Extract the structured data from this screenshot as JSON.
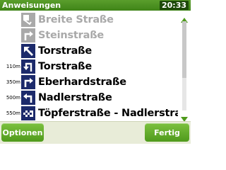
{
  "header": {
    "title": "Anweisungen",
    "clock": "20:33"
  },
  "rows": [
    {
      "distance": "",
      "street": "Breite Straße",
      "state": "past",
      "icon": "roundabout-icon"
    },
    {
      "distance": "",
      "street": "Steinstraße",
      "state": "past",
      "icon": "turn-right-icon"
    },
    {
      "distance": "",
      "street": "Torstraße",
      "state": "current",
      "icon": "keep-left-icon"
    },
    {
      "distance": "110m",
      "street": "Torstraße",
      "state": "current",
      "icon": "u-turn-left-icon"
    },
    {
      "distance": "350m",
      "street": "Eberhardstraße",
      "state": "current",
      "icon": "turn-right-icon"
    },
    {
      "distance": "500m",
      "street": "Nadlerstraße",
      "state": "current",
      "icon": "turn-left-icon"
    },
    {
      "distance": "550m",
      "street": "Töpferstraße - Nadlerstraß...",
      "state": "current",
      "icon": "destination-flag-icon"
    }
  ],
  "footer": {
    "options_label": "Optionen",
    "done_label": "Fertig"
  },
  "colors": {
    "accent": "#4f9a1c",
    "icon_active": "#1c2a6b",
    "icon_past": "#a9a9a9"
  }
}
